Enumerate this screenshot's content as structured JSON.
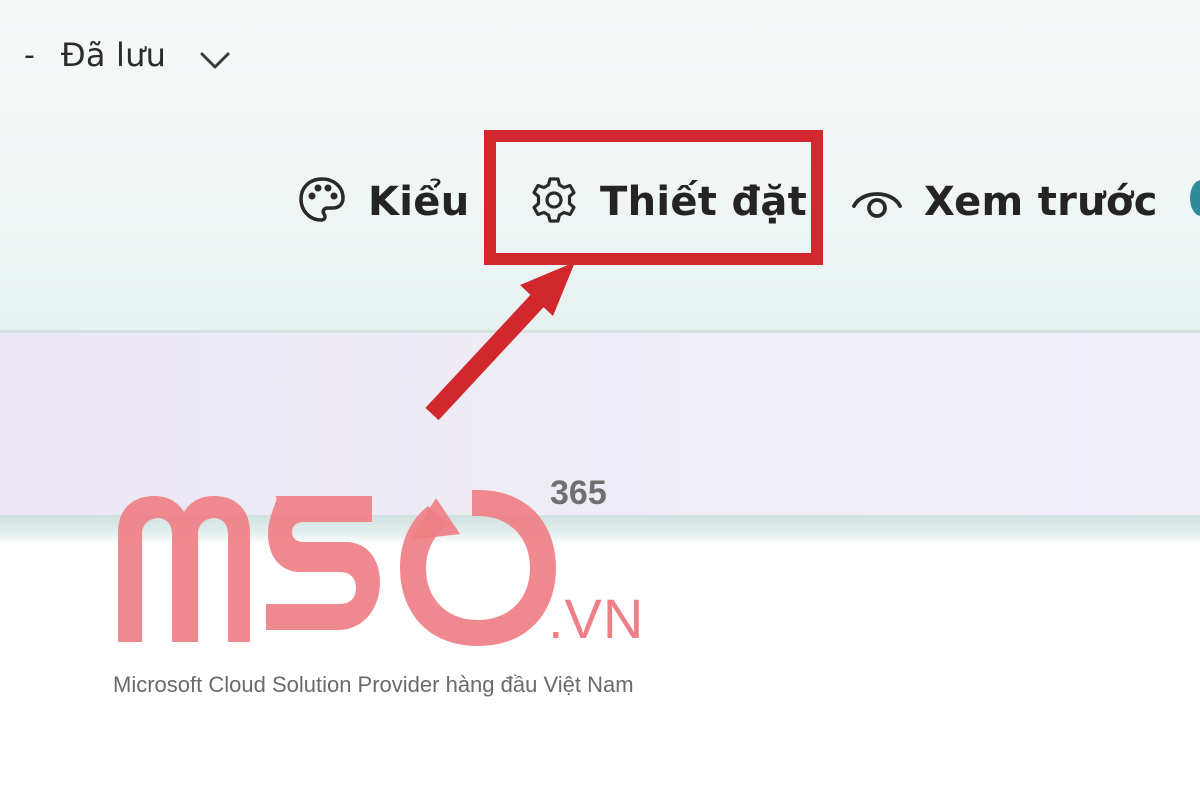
{
  "header": {
    "dash": "-",
    "save_status": "Đã lưu",
    "chevron_icon": "chevron-down-icon"
  },
  "toolbar": {
    "items": [
      {
        "label": "Kiểu",
        "icon": "palette-icon"
      },
      {
        "label": "Thiết đặt",
        "icon": "gear-icon"
      },
      {
        "label": "Xem trước",
        "icon": "eye-icon"
      }
    ]
  },
  "annotation": {
    "highlight_color": "#d1272d"
  },
  "watermark": {
    "brand": "MSO",
    "superscript": "365",
    "domain": ".VN",
    "tagline": "Microsoft Cloud Solution Provider hàng đầu Việt Nam",
    "color": "#ef7f86"
  }
}
